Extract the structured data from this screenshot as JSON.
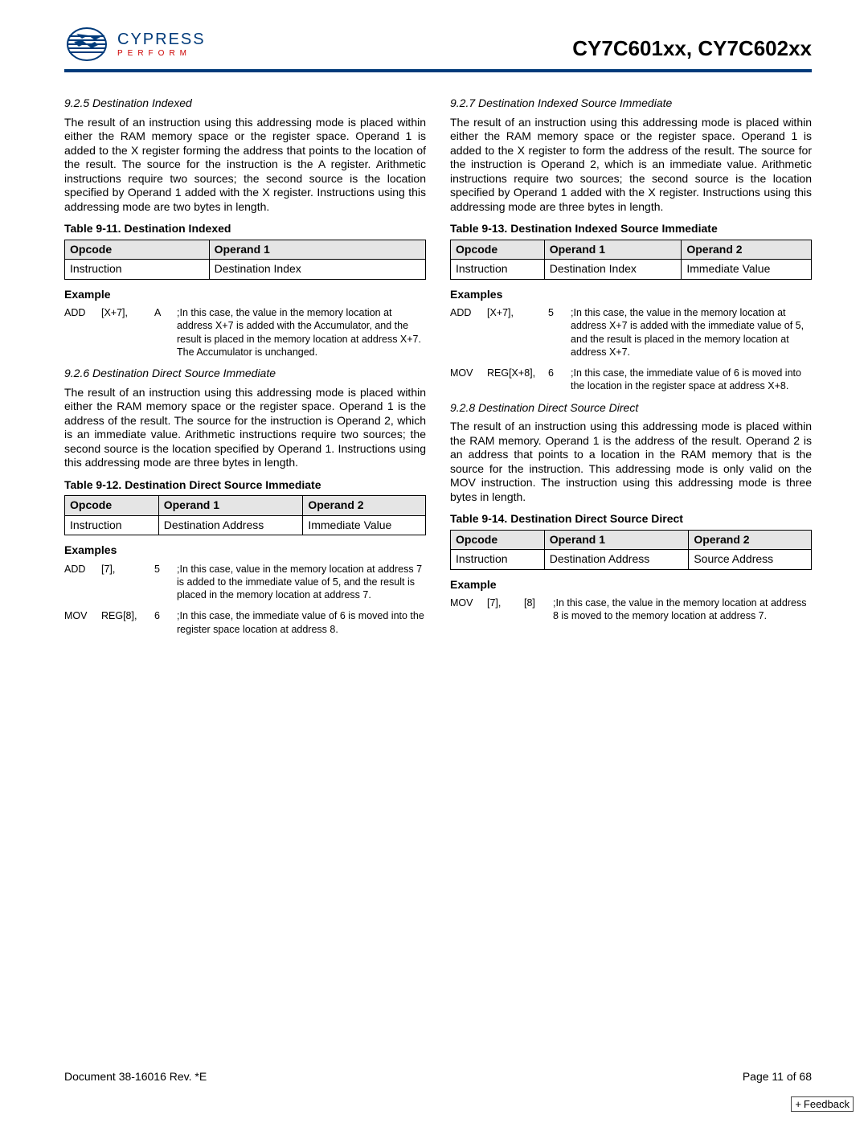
{
  "header": {
    "logo_name": "CYPRESS",
    "logo_tag": "PERFORM",
    "title": "CY7C601xx, CY7C602xx"
  },
  "left": {
    "s925": {
      "heading": "9.2.5  Destination Indexed",
      "body": "The result of an instruction using this addressing mode is placed within either the RAM memory space or the register space. Operand 1 is added to the X register forming the address that points to the location of the result. The source for the instruction is the A register. Arithmetic instructions require two sources; the second source is the location specified by Operand 1 added with the X register. Instructions using this addressing mode are two bytes in length.",
      "table_caption": "Table 9-11.  Destination Indexed",
      "th1": "Opcode",
      "th2": "Operand 1",
      "td1": "Instruction",
      "td2": "Destination Index",
      "example_label": "Example",
      "ex1": {
        "mn": "ADD",
        "o1": "[X+7],",
        "o2": "A",
        "desc": ";In this case, the value in the memory location at address X+7 is added with the Accumulator, and the result is placed in the memory location at address X+7. The Accumulator is unchanged."
      }
    },
    "s926": {
      "heading": "9.2.6  Destination Direct Source Immediate",
      "body": "The result of an instruction using this addressing mode is placed within either the RAM memory space or the register space. Operand 1 is the address of the result. The source for the instruction is Operand 2, which is an immediate value. Arithmetic instructions require two sources; the second source is the location specified by Operand 1. Instructions using this addressing mode are three bytes in length.",
      "table_caption": "Table 9-12.  Destination Direct Source Immediate",
      "th1": "Opcode",
      "th2": "Operand 1",
      "th3": "Operand 2",
      "td1": "Instruction",
      "td2": "Destination Address",
      "td3": "Immediate Value",
      "example_label": "Examples",
      "ex1": {
        "mn": "ADD",
        "o1": "[7],",
        "o2": "5",
        "desc": ";In this case, value in the memory location at address 7 is added to the immediate value of 5, and the result is placed in the memory location at address 7."
      },
      "ex2": {
        "mn": "MOV",
        "o1": "REG[8],",
        "o2": "6",
        "desc": ";In this case, the immediate value of 6 is moved into the register space location at address 8."
      }
    }
  },
  "right": {
    "s927": {
      "heading": "9.2.7  Destination Indexed Source Immediate",
      "body": "The result of an instruction using this addressing mode is placed within either the RAM memory space or the register space. Operand 1 is added to the X register to form the address of the result. The source for the instruction is Operand 2, which is an immediate value. Arithmetic instructions require two sources; the second source is the location specified by Operand 1 added with the X register. Instructions using this addressing mode are three bytes in length.",
      "table_caption": "Table 9-13.  Destination Indexed Source Immediate",
      "th1": "Opcode",
      "th2": "Operand 1",
      "th3": "Operand 2",
      "td1": "Instruction",
      "td2": "Destination Index",
      "td3": "Immediate Value",
      "example_label": "Examples",
      "ex1": {
        "mn": "ADD",
        "o1": "[X+7],",
        "o2": "5",
        "desc": ";In this case, the value in the memory location at address X+7 is added with the immediate value of 5, and the result is placed in the memory location at address X+7."
      },
      "ex2": {
        "mn": "MOV",
        "o1": "REG[X+8],",
        "o2": "6",
        "desc": ";In this case, the immediate value of 6 is moved into the location in the register space at address X+8."
      }
    },
    "s928": {
      "heading": "9.2.8  Destination Direct Source Direct",
      "body": "The result of an instruction using this addressing mode is placed within the RAM memory. Operand 1 is the address of the result. Operand 2 is an address that points to a location in the RAM memory that is the source for the instruction. This addressing mode is only valid on the MOV instruction. The instruction using this addressing mode is three bytes in length.",
      "table_caption": "Table 9-14.  Destination Direct Source Direct",
      "th1": "Opcode",
      "th2": "Operand 1",
      "th3": "Operand 2",
      "td1": "Instruction",
      "td2": "Destination Address",
      "td3": "Source Address",
      "example_label": "Example",
      "ex1": {
        "mn": "MOV",
        "o1": "[7],",
        "o2": "[8]",
        "desc": ";In this case, the value in the memory location at address 8 is moved to the memory location at address 7."
      }
    }
  },
  "footer": {
    "doc": "Document 38-16016 Rev. *E",
    "page": "Page 11 of 68",
    "feedback": "Feedback"
  }
}
